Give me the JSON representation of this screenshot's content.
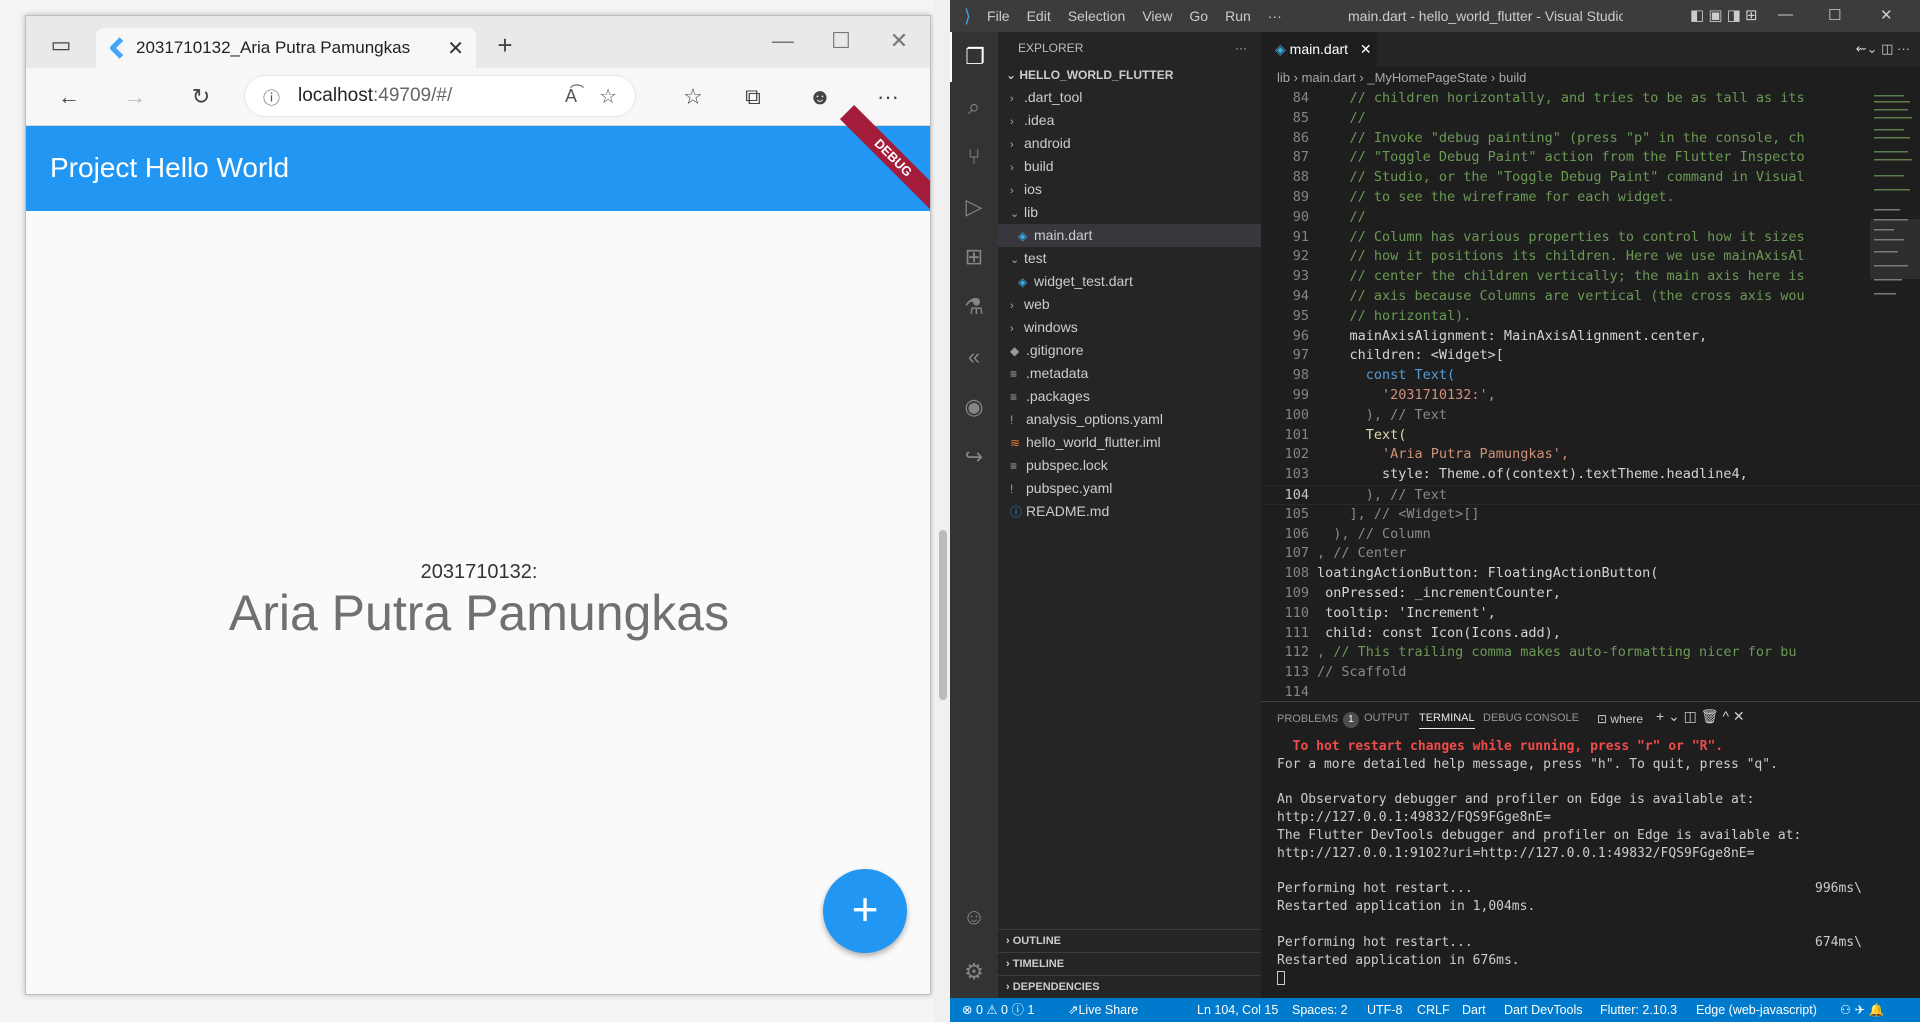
{
  "browser": {
    "tab_title": "2031710132_Aria Putra Pamungkas",
    "tab_close": "✕",
    "new_tab": "+",
    "address_host": "localhost",
    "address_rest": ":49709/#/",
    "window_controls": {
      "minimize": "—",
      "maximize": "☐",
      "close": "✕"
    }
  },
  "app": {
    "title": "Project Hello World",
    "debug_banner": "DEBUG",
    "label": "2031710132:",
    "name": "Aria Putra Pamungkas",
    "fab_label": "+"
  },
  "vscode": {
    "menu": [
      "File",
      "Edit",
      "Selection",
      "View",
      "Go",
      "Run",
      "···"
    ],
    "window_title": "main.dart - hello_world_flutter - Visual Studio Code [Ad...",
    "explorer": {
      "header": "EXPLORER",
      "root": "HELLO_WORLD_FLUTTER",
      "items": [
        {
          "label": ".dart_tool",
          "type": "folder",
          "indent": 1
        },
        {
          "label": ".idea",
          "type": "folder",
          "indent": 1
        },
        {
          "label": "android",
          "type": "folder",
          "indent": 1
        },
        {
          "label": "build",
          "type": "folder",
          "indent": 1
        },
        {
          "label": "ios",
          "type": "folder",
          "indent": 1
        },
        {
          "label": "lib",
          "type": "folder-open",
          "indent": 1
        },
        {
          "label": "main.dart",
          "type": "dart",
          "indent": 2,
          "selected": true
        },
        {
          "label": "test",
          "type": "folder-open",
          "indent": 1
        },
        {
          "label": "widget_test.dart",
          "type": "dart",
          "indent": 2
        },
        {
          "label": "web",
          "type": "folder",
          "indent": 1
        },
        {
          "label": "windows",
          "type": "folder",
          "indent": 1
        },
        {
          "label": ".gitignore",
          "type": "git",
          "indent": 1
        },
        {
          "label": ".metadata",
          "type": "lines",
          "indent": 1
        },
        {
          "label": ".packages",
          "type": "lines",
          "indent": 1
        },
        {
          "label": "analysis_options.yaml",
          "type": "yaml",
          "indent": 1
        },
        {
          "label": "hello_world_flutter.iml",
          "type": "rss",
          "indent": 1
        },
        {
          "label": "pubspec.lock",
          "type": "lines",
          "indent": 1
        },
        {
          "label": "pubspec.yaml",
          "type": "yaml",
          "indent": 1
        },
        {
          "label": "README.md",
          "type": "info",
          "indent": 1
        }
      ],
      "sections": [
        "OUTLINE",
        "TIMELINE",
        "DEPENDENCIES"
      ]
    },
    "editor_tab": "main.dart",
    "breadcrumb": [
      "lib",
      "main.dart",
      "_MyHomePageState",
      "build"
    ],
    "code_lines": [
      {
        "n": "84",
        "t": "    // children horizontally, and tries to be as tall as its",
        "c": "cm"
      },
      {
        "n": "85",
        "t": "    //",
        "c": "cm"
      },
      {
        "n": "86",
        "t": "    // Invoke \"debug painting\" (press \"p\" in the console, ch",
        "c": "cm"
      },
      {
        "n": "87",
        "t": "    // \"Toggle Debug Paint\" action from the Flutter Inspecto",
        "c": "cm"
      },
      {
        "n": "88",
        "t": "    // Studio, or the \"Toggle Debug Paint\" command in Visual",
        "c": "cm"
      },
      {
        "n": "89",
        "t": "    // to see the wireframe for each widget.",
        "c": "cm"
      },
      {
        "n": "90",
        "t": "    //",
        "c": "cm"
      },
      {
        "n": "91",
        "t": "    // Column has various properties to control how it sizes",
        "c": "cm"
      },
      {
        "n": "92",
        "t": "    // how it positions its children. Here we use mainAxisAl",
        "c": "cm"
      },
      {
        "n": "93",
        "t": "    // center the children vertically; the main axis here is",
        "c": "cm"
      },
      {
        "n": "94",
        "t": "    // axis because Columns are vertical (the cross axis wou",
        "c": "cm"
      },
      {
        "n": "95",
        "t": "    // horizontal).",
        "c": "cm"
      },
      {
        "n": "96",
        "t": "    mainAxisAlignment: MainAxisAlignment.center,",
        "c": "pl"
      },
      {
        "n": "97",
        "t": "    children: <Widget>[",
        "c": "pl"
      },
      {
        "n": "98",
        "t": "      const Text(",
        "c": "kwt"
      },
      {
        "n": "99",
        "t": "        '2031710132:',",
        "c": "st"
      },
      {
        "n": "100",
        "t": "      ), // Text",
        "c": "gh"
      },
      {
        "n": "101",
        "t": "      Text(",
        "c": "fn"
      },
      {
        "n": "102",
        "t": "        'Aria Putra Pamungkas',",
        "c": "st"
      },
      {
        "n": "103",
        "t": "        style: Theme.of(context).textTheme.headline4,",
        "c": "pl"
      },
      {
        "n": "104",
        "t": "      ), // Text",
        "c": "gh",
        "cur": true
      },
      {
        "n": "105",
        "t": "    ], // <Widget>[]",
        "c": "gh"
      },
      {
        "n": "106",
        "t": "  ), // Column",
        "c": "gh"
      },
      {
        "n": "107",
        "t": ", // Center",
        "c": "gh"
      },
      {
        "n": "108",
        "t": "loatingActionButton: FloatingActionButton(",
        "c": "pl"
      },
      {
        "n": "109",
        "t": " onPressed: _incrementCounter,",
        "c": "pl"
      },
      {
        "n": "110",
        "t": " tooltip: 'Increment',",
        "c": "pl"
      },
      {
        "n": "111",
        "t": " child: const Icon(Icons.add),",
        "c": "pl"
      },
      {
        "n": "112",
        "t": ", // This trailing comma makes auto-formatting nicer for bu",
        "c": "cm"
      },
      {
        "n": "113",
        "t": "// Scaffold",
        "c": "gh"
      },
      {
        "n": "114",
        "t": "",
        "c": "pl"
      }
    ],
    "panel": {
      "tabs": [
        "PROBLEMS",
        "OUTPUT",
        "TERMINAL",
        "DEBUG CONSOLE"
      ],
      "problems_count": "1",
      "shell": "where",
      "terminal": [
        {
          "t": "  To hot restart changes while running, press \"r\" or \"R\".",
          "red": true
        },
        {
          "t": "For a more detailed help message, press \"h\". To quit, press \"q\"."
        },
        {
          "t": ""
        },
        {
          "t": "An Observatory debugger and profiler on Edge is available at:"
        },
        {
          "t": "http://127.0.0.1:49832/FQS9FGge8nE="
        },
        {
          "t": "The Flutter DevTools debugger and profiler on Edge is available at:"
        },
        {
          "t": "http://127.0.0.1:9102?uri=http://127.0.0.1:49832/FQS9FGge8nE="
        },
        {
          "t": ""
        },
        {
          "t": "Performing hot restart...",
          "right": "996ms\\"
        },
        {
          "t": "Restarted application in 1,004ms."
        },
        {
          "t": ""
        },
        {
          "t": "Performing hot restart...",
          "right": "674ms\\"
        },
        {
          "t": "Restarted application in 676ms."
        }
      ]
    },
    "status": {
      "problems": "⊗ 0 ⚠ 0 ⓘ 1",
      "live_share": "Live Share",
      "position": "Ln 104, Col 15",
      "spaces": "Spaces: 2",
      "encoding": "UTF-8",
      "eol": "CRLF",
      "language": "Dart",
      "devtools": "Dart DevTools",
      "flutter": "Flutter: 2.10.3",
      "device": "Edge (web-javascript)"
    },
    "accent": "#007acc"
  },
  "colors": {
    "flutter_blue": "#2196f3",
    "debug_red": "#a31c3a"
  }
}
